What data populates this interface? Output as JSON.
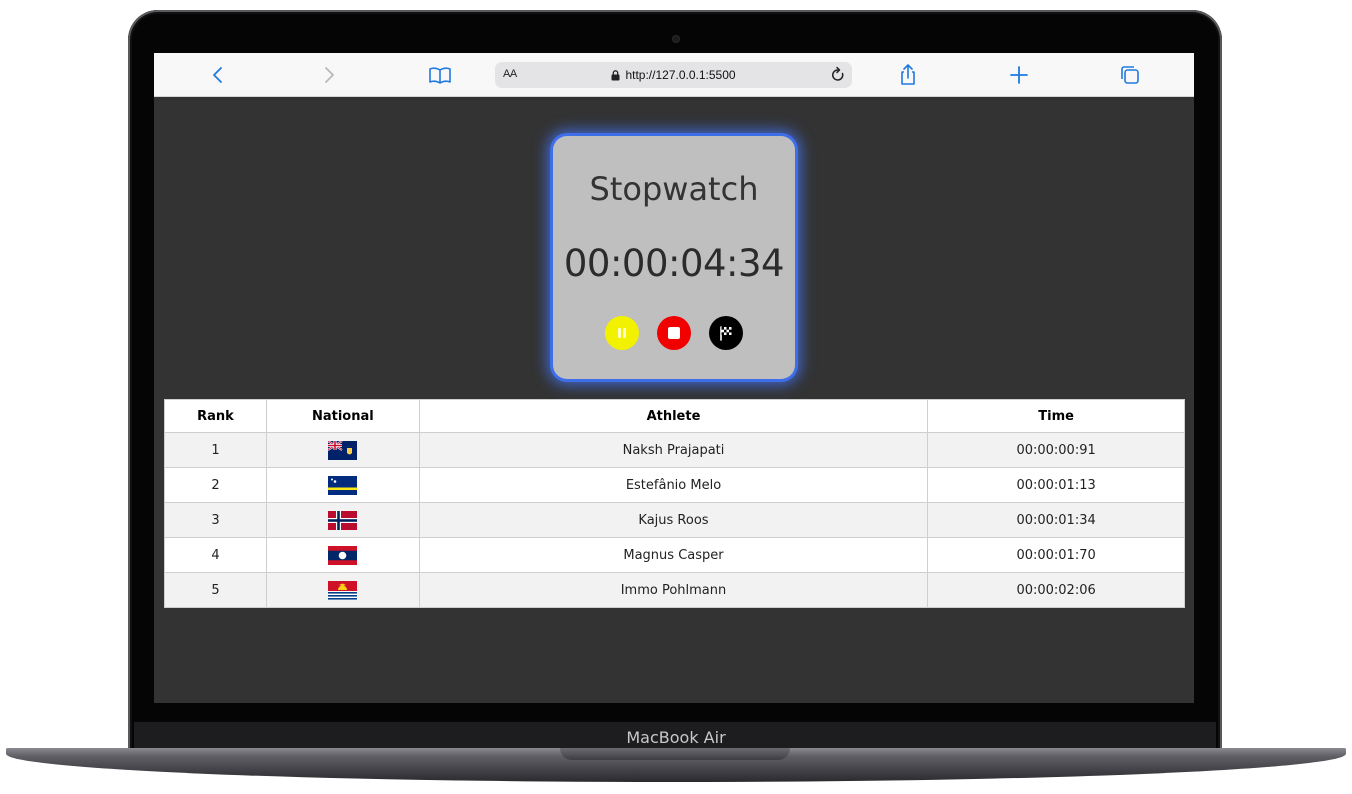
{
  "device": {
    "brand_label": "MacBook Air"
  },
  "browser": {
    "aa_label": "AA",
    "url": "http://127.0.0.1:5500",
    "icons": [
      "back-icon",
      "forward-icon",
      "bookmarks-icon",
      "lock-icon",
      "reload-icon",
      "share-icon",
      "new-tab-icon",
      "tabs-icon"
    ]
  },
  "stopwatch": {
    "title": "Stopwatch",
    "time": "00:00:04:34",
    "controls": [
      {
        "name": "pause",
        "icon": "pause-icon",
        "color": "#f2f200"
      },
      {
        "name": "stop",
        "icon": "stop-icon",
        "color": "#f20000"
      },
      {
        "name": "lap",
        "icon": "flag-icon",
        "color": "#000000"
      }
    ]
  },
  "table": {
    "headers": [
      "Rank",
      "National",
      "Athlete",
      "Time"
    ],
    "rows": [
      {
        "rank": "1",
        "flag": "turks-and-caicos-flag",
        "athlete": "Naksh Prajapati",
        "time": "00:00:00:91"
      },
      {
        "rank": "2",
        "flag": "curacao-flag",
        "athlete": "Estefânio Melo",
        "time": "00:00:01:13"
      },
      {
        "rank": "3",
        "flag": "norway-flag",
        "athlete": "Kajus Roos",
        "time": "00:00:01:34"
      },
      {
        "rank": "4",
        "flag": "laos-flag",
        "athlete": "Magnus Casper",
        "time": "00:00:01:70"
      },
      {
        "rank": "5",
        "flag": "kiribati-flag",
        "athlete": "Immo Pohlmann",
        "time": "00:00:02:06"
      }
    ]
  },
  "colors": {
    "accent": "#3f6fe8",
    "page_bg": "#333333",
    "card_bg": "#bfbfbf",
    "browser_blue": "#1f7ae0"
  }
}
